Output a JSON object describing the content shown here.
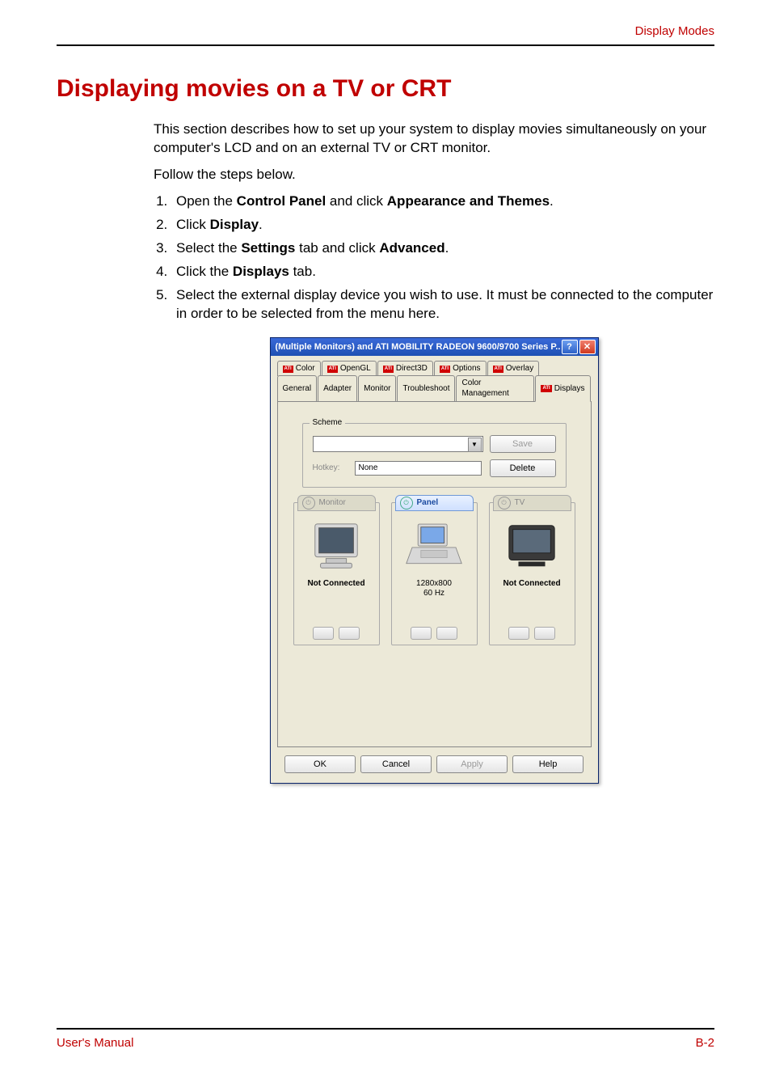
{
  "header": {
    "right_label": "Display Modes"
  },
  "title": "Displaying movies on a TV or CRT",
  "intro_p1": "This section describes how to set up your system to display movies simultaneously on your computer's LCD and on an external TV or CRT monitor.",
  "intro_p2": "Follow the steps below.",
  "steps": {
    "s1_a": "Open the ",
    "s1_b": "Control Panel",
    "s1_c": " and click ",
    "s1_d": "Appearance and Themes",
    "s1_e": ".",
    "s2_a": "Click ",
    "s2_b": "Display",
    "s2_c": ".",
    "s3_a": "Select the ",
    "s3_b": "Settings",
    "s3_c": " tab and click ",
    "s3_d": "Advanced",
    "s3_e": ".",
    "s4_a": "Click the ",
    "s4_b": "Displays",
    "s4_c": " tab.",
    "s5": "Select the external display device you wish to use. It must be connected to the computer in order to be selected from the menu here."
  },
  "dialog": {
    "title": "(Multiple Monitors) and ATI MOBILITY RADEON 9600/9700 Series P...",
    "help_glyph": "?",
    "close_glyph": "✕",
    "tabs_upper": [
      "Color",
      "OpenGL",
      "Direct3D",
      "Options",
      "Overlay"
    ],
    "tabs_lower": [
      "General",
      "Adapter",
      "Monitor",
      "Troubleshoot",
      "Color Management",
      "Displays"
    ],
    "ati_logo": "ATI",
    "scheme": {
      "legend": "Scheme",
      "hotkey_label": "Hotkey:",
      "hotkey_value": "None",
      "save_label": "Save",
      "delete_label": "Delete"
    },
    "displays": {
      "monitor": {
        "name": "Monitor",
        "status": "Not Connected",
        "power": "⏻"
      },
      "panel": {
        "name": "Panel",
        "resolution": "1280x800",
        "refresh": "60 Hz",
        "power": "⏻"
      },
      "tv": {
        "name": "TV",
        "status": "Not Connected",
        "power": "⏻"
      }
    },
    "buttons": {
      "ok": "OK",
      "cancel": "Cancel",
      "apply": "Apply",
      "help": "Help"
    },
    "dropdown_glyph": "▼"
  },
  "footer": {
    "left": "User's Manual",
    "right": "B-2"
  }
}
